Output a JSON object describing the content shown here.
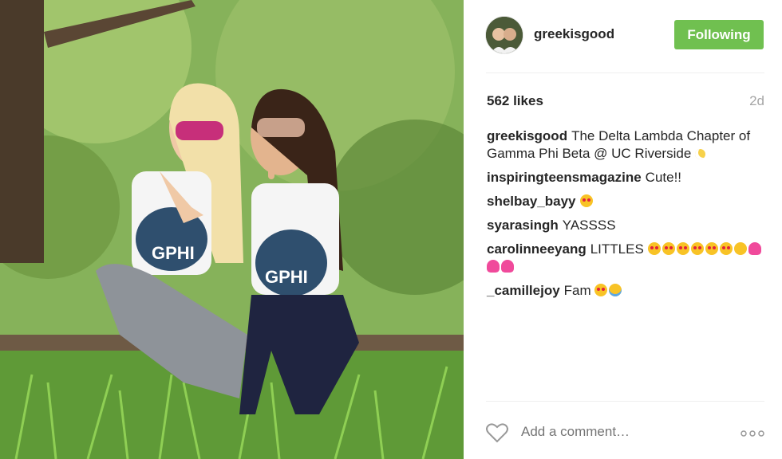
{
  "post": {
    "username": "greekisgood",
    "follow_label": "Following",
    "likes": "562 likes",
    "age": "2d"
  },
  "comments": [
    {
      "user": "greekisgood",
      "text": "The Delta Lambda Chapter of Gamma Phi Beta @ UC Riverside",
      "emojis": [
        "moon"
      ]
    },
    {
      "user": "inspiringteensmagazine",
      "text": "Cute!!",
      "emojis": []
    },
    {
      "user": "shelbay_bayy",
      "text": "",
      "emojis": [
        "heart-eyes"
      ]
    },
    {
      "user": "syarasingh",
      "text": "YASSSS",
      "emojis": []
    },
    {
      "user": "carolinneeyang",
      "text": "LITTLES",
      "emojis": [
        "heart-eyes",
        "heart-eyes",
        "heart-eyes",
        "heart-eyes",
        "heart-eyes",
        "heart-eyes",
        "weary",
        "pink-heart",
        "pink-heart",
        "pink-heart"
      ]
    },
    {
      "user": "_camillejoy",
      "text": "Fam",
      "emojis": [
        "heart-eyes",
        "sob"
      ]
    }
  ],
  "comment_box": {
    "placeholder": "Add a comment…"
  },
  "photo": {
    "shirt_text_left": "GPHI",
    "shirt_text_right": "GPHI"
  },
  "colors": {
    "follow_button": "#70c050",
    "text": "#262626",
    "muted": "#a5a5a5"
  },
  "icons": {
    "like": "heart-outline-icon",
    "more": "more-options-icon"
  }
}
